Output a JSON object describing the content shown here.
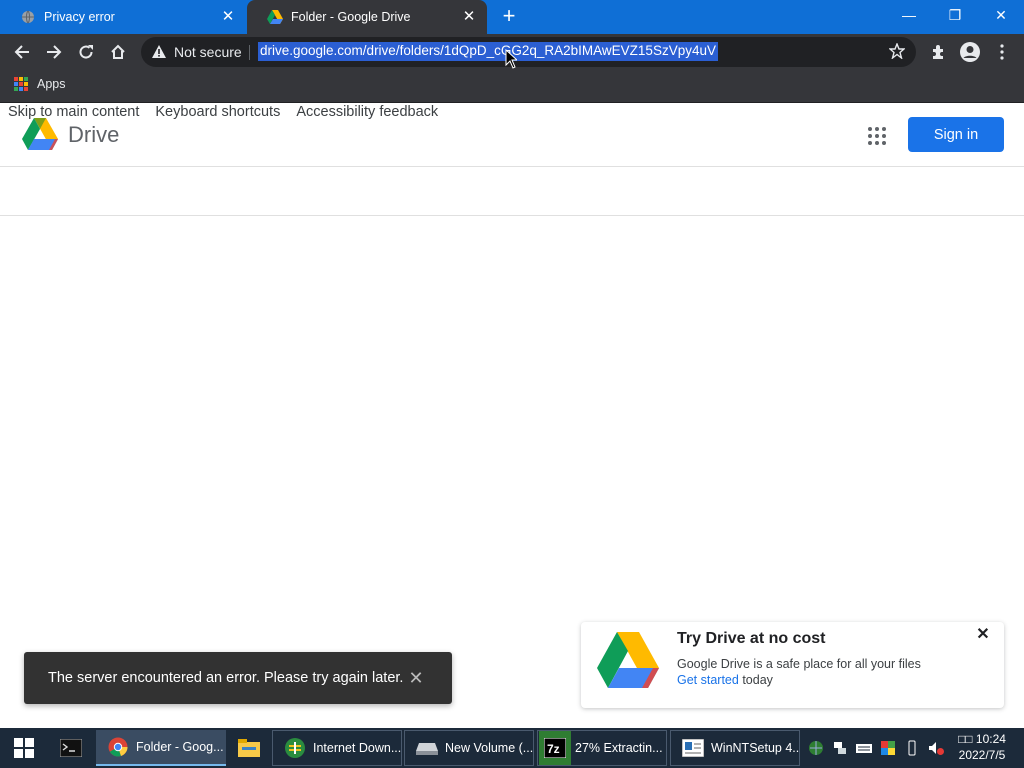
{
  "tabs": [
    {
      "title": "Privacy error",
      "icon": "globe-icon",
      "active": false
    },
    {
      "title": "Folder - Google Drive",
      "icon": "google-drive-icon",
      "active": true
    }
  ],
  "window_controls": {
    "minimize": "—",
    "maximize": "❐",
    "close": "✕"
  },
  "omnibox": {
    "security_label": "Not secure",
    "url": "drive.google.com/drive/folders/1dQpD_cGG2q_RA2bIMAwEVZ15SzVpy4uV"
  },
  "bookmarks": {
    "apps_label": "Apps"
  },
  "page": {
    "skip_links": [
      "Skip to main content",
      "Keyboard shortcuts",
      "Accessibility feedback"
    ],
    "product_name": "Drive",
    "sign_in_label": "Sign in",
    "snackbar_message": "The server encountered an error. Please try again later.",
    "promo": {
      "title": "Try Drive at no cost",
      "description": "Google Drive is a safe place for all your files",
      "link_text": "Get started",
      "link_suffix": " today"
    }
  },
  "taskbar": {
    "items": [
      {
        "label": "Folder - Goog...",
        "icon": "chrome-icon"
      },
      {
        "label": "",
        "icon": "file-explorer-icon"
      },
      {
        "label": "Internet Down...",
        "icon": "idm-icon"
      },
      {
        "label": "New Volume (...",
        "icon": "drive-volume-icon"
      },
      {
        "label": "27% Extractin...",
        "icon": "7zip-icon"
      },
      {
        "label": "WinNTSetup 4...",
        "icon": "winntsetup-icon"
      }
    ],
    "clock": {
      "time": "10:24",
      "date": "2022/7/5",
      "prefix": "□□"
    }
  },
  "colors": {
    "tab_strip": "#0f6fd6",
    "toolbar": "#35363a",
    "url_selection": "#2b5fd3",
    "sign_in": "#1a73e8",
    "snackbar": "#323232",
    "taskbar": "#1c2a3a"
  }
}
